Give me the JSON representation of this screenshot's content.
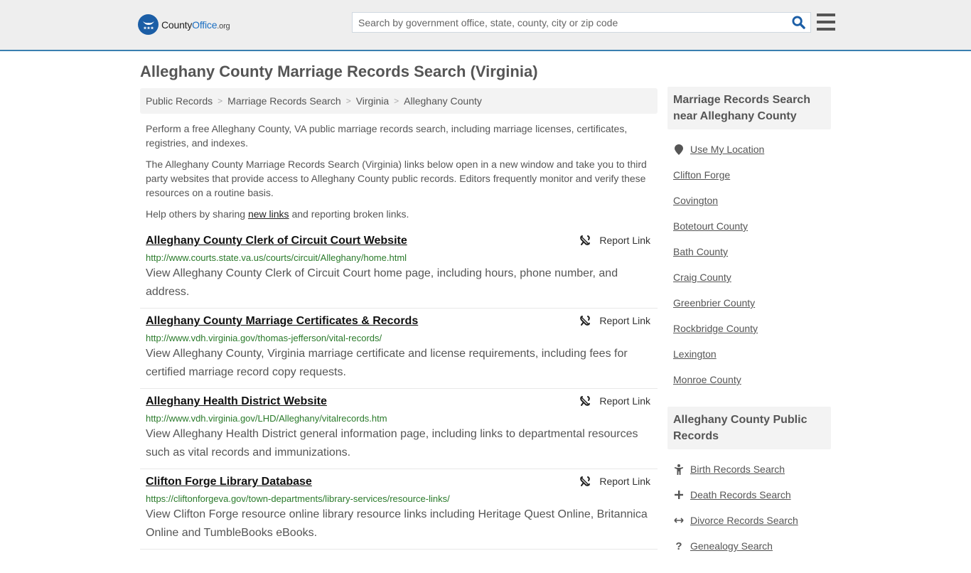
{
  "header": {
    "logo": {
      "name": "County",
      "name_accent": "Office",
      "tld": ".org"
    },
    "search": {
      "placeholder": "Search by government office, state, county, city or zip code",
      "value": ""
    }
  },
  "page_title": "Alleghany County Marriage Records Search (Virginia)",
  "breadcrumb": [
    "Public Records",
    "Marriage Records Search",
    "Virginia",
    "Alleghany County"
  ],
  "intro": {
    "p1": "Perform a free Alleghany County, VA public marriage records search, including marriage licenses, certificates, registries, and indexes.",
    "p2": "The Alleghany County Marriage Records Search (Virginia) links below open in a new window and take you to third party websites that provide access to Alleghany County public records. Editors frequently monitor and verify these resources on a routine basis.",
    "p3_before": "Help others by sharing ",
    "p3_link": "new links",
    "p3_after": " and reporting broken links."
  },
  "report_label": "Report Link",
  "results": [
    {
      "title": "Alleghany County Clerk of Circuit Court Website",
      "url": "http://www.courts.state.va.us/courts/circuit/Alleghany/home.html",
      "desc": "View Alleghany County Clerk of Circuit Court home page, including hours, phone number, and address."
    },
    {
      "title": "Alleghany County Marriage Certificates & Records",
      "url": "http://www.vdh.virginia.gov/thomas-jefferson/vital-records/",
      "desc": "View Alleghany County, Virginia marriage certificate and license requirements, including fees for certified marriage record copy requests."
    },
    {
      "title": "Alleghany Health District Website",
      "url": "http://www.vdh.virginia.gov/LHD/Alleghany/vitalrecords.htm",
      "desc": "View Alleghany Health District general information page, including links to departmental resources such as vital records and immunizations."
    },
    {
      "title": "Clifton Forge Library Database",
      "url": "https://cliftonforgeva.gov/town-departments/library-services/resource-links/",
      "desc": "View Clifton Forge resource online library resource links including Heritage Quest Online, Britannica Online and TumbleBooks eBooks."
    }
  ],
  "sidebar": {
    "nearby": {
      "heading": "Marriage Records Search near Alleghany County",
      "use_location": "Use My Location",
      "items": [
        "Clifton Forge",
        "Covington",
        "Botetourt County",
        "Bath County",
        "Craig County",
        "Greenbrier County",
        "Rockbridge County",
        "Lexington",
        "Monroe County"
      ]
    },
    "public_records": {
      "heading": "Alleghany County Public Records",
      "items": [
        {
          "label": "Birth Records Search",
          "icon": "child-icon"
        },
        {
          "label": "Death Records Search",
          "icon": "cross-icon"
        },
        {
          "label": "Divorce Records Search",
          "icon": "arrows-horizontal-icon"
        },
        {
          "label": "Genealogy Search",
          "icon": "question-icon"
        }
      ]
    }
  },
  "colors": {
    "accent": "#1b6fc2",
    "header_border": "#3a7fb0",
    "url_green": "#2a7a2a"
  }
}
